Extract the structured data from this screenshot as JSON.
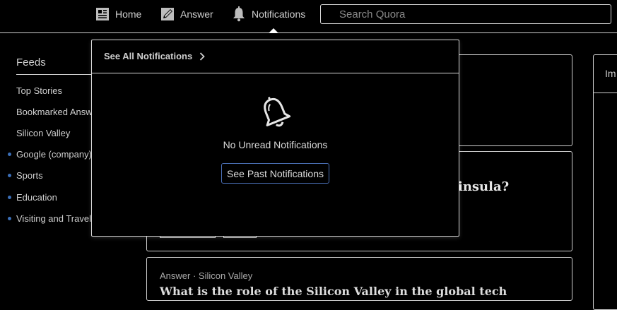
{
  "nav": {
    "home_label": "Home",
    "answer_label": "Answer",
    "notifications_label": "Notifications",
    "search_placeholder": "Search Quora"
  },
  "sidebar": {
    "title": "Feeds",
    "items": [
      {
        "label": "Top Stories",
        "dot": false
      },
      {
        "label": "Bookmarked Answers",
        "dot": false
      },
      {
        "label": "Silicon Valley",
        "dot": false
      },
      {
        "label": "Google (company)",
        "dot": true
      },
      {
        "label": "Sports",
        "dot": true
      },
      {
        "label": "Education",
        "dot": true
      },
      {
        "label": "Visiting and Travel",
        "dot": true
      }
    ]
  },
  "feed": {
    "card2_title_fragment": "insula?",
    "card3_meta": "Answer · Silicon Valley",
    "card3_title_fragment": "What is the role of the Silicon Valley in the global tech"
  },
  "right_panel": {
    "label_fragment": "Im"
  },
  "notifications": {
    "see_all_label": "See All Notifications",
    "empty_message": "No Unread Notifications",
    "past_button_label": "See Past Notifications"
  },
  "colors": {
    "accent": "#4a6fb5",
    "dot": "#3b6fb8",
    "background": "#000000"
  }
}
